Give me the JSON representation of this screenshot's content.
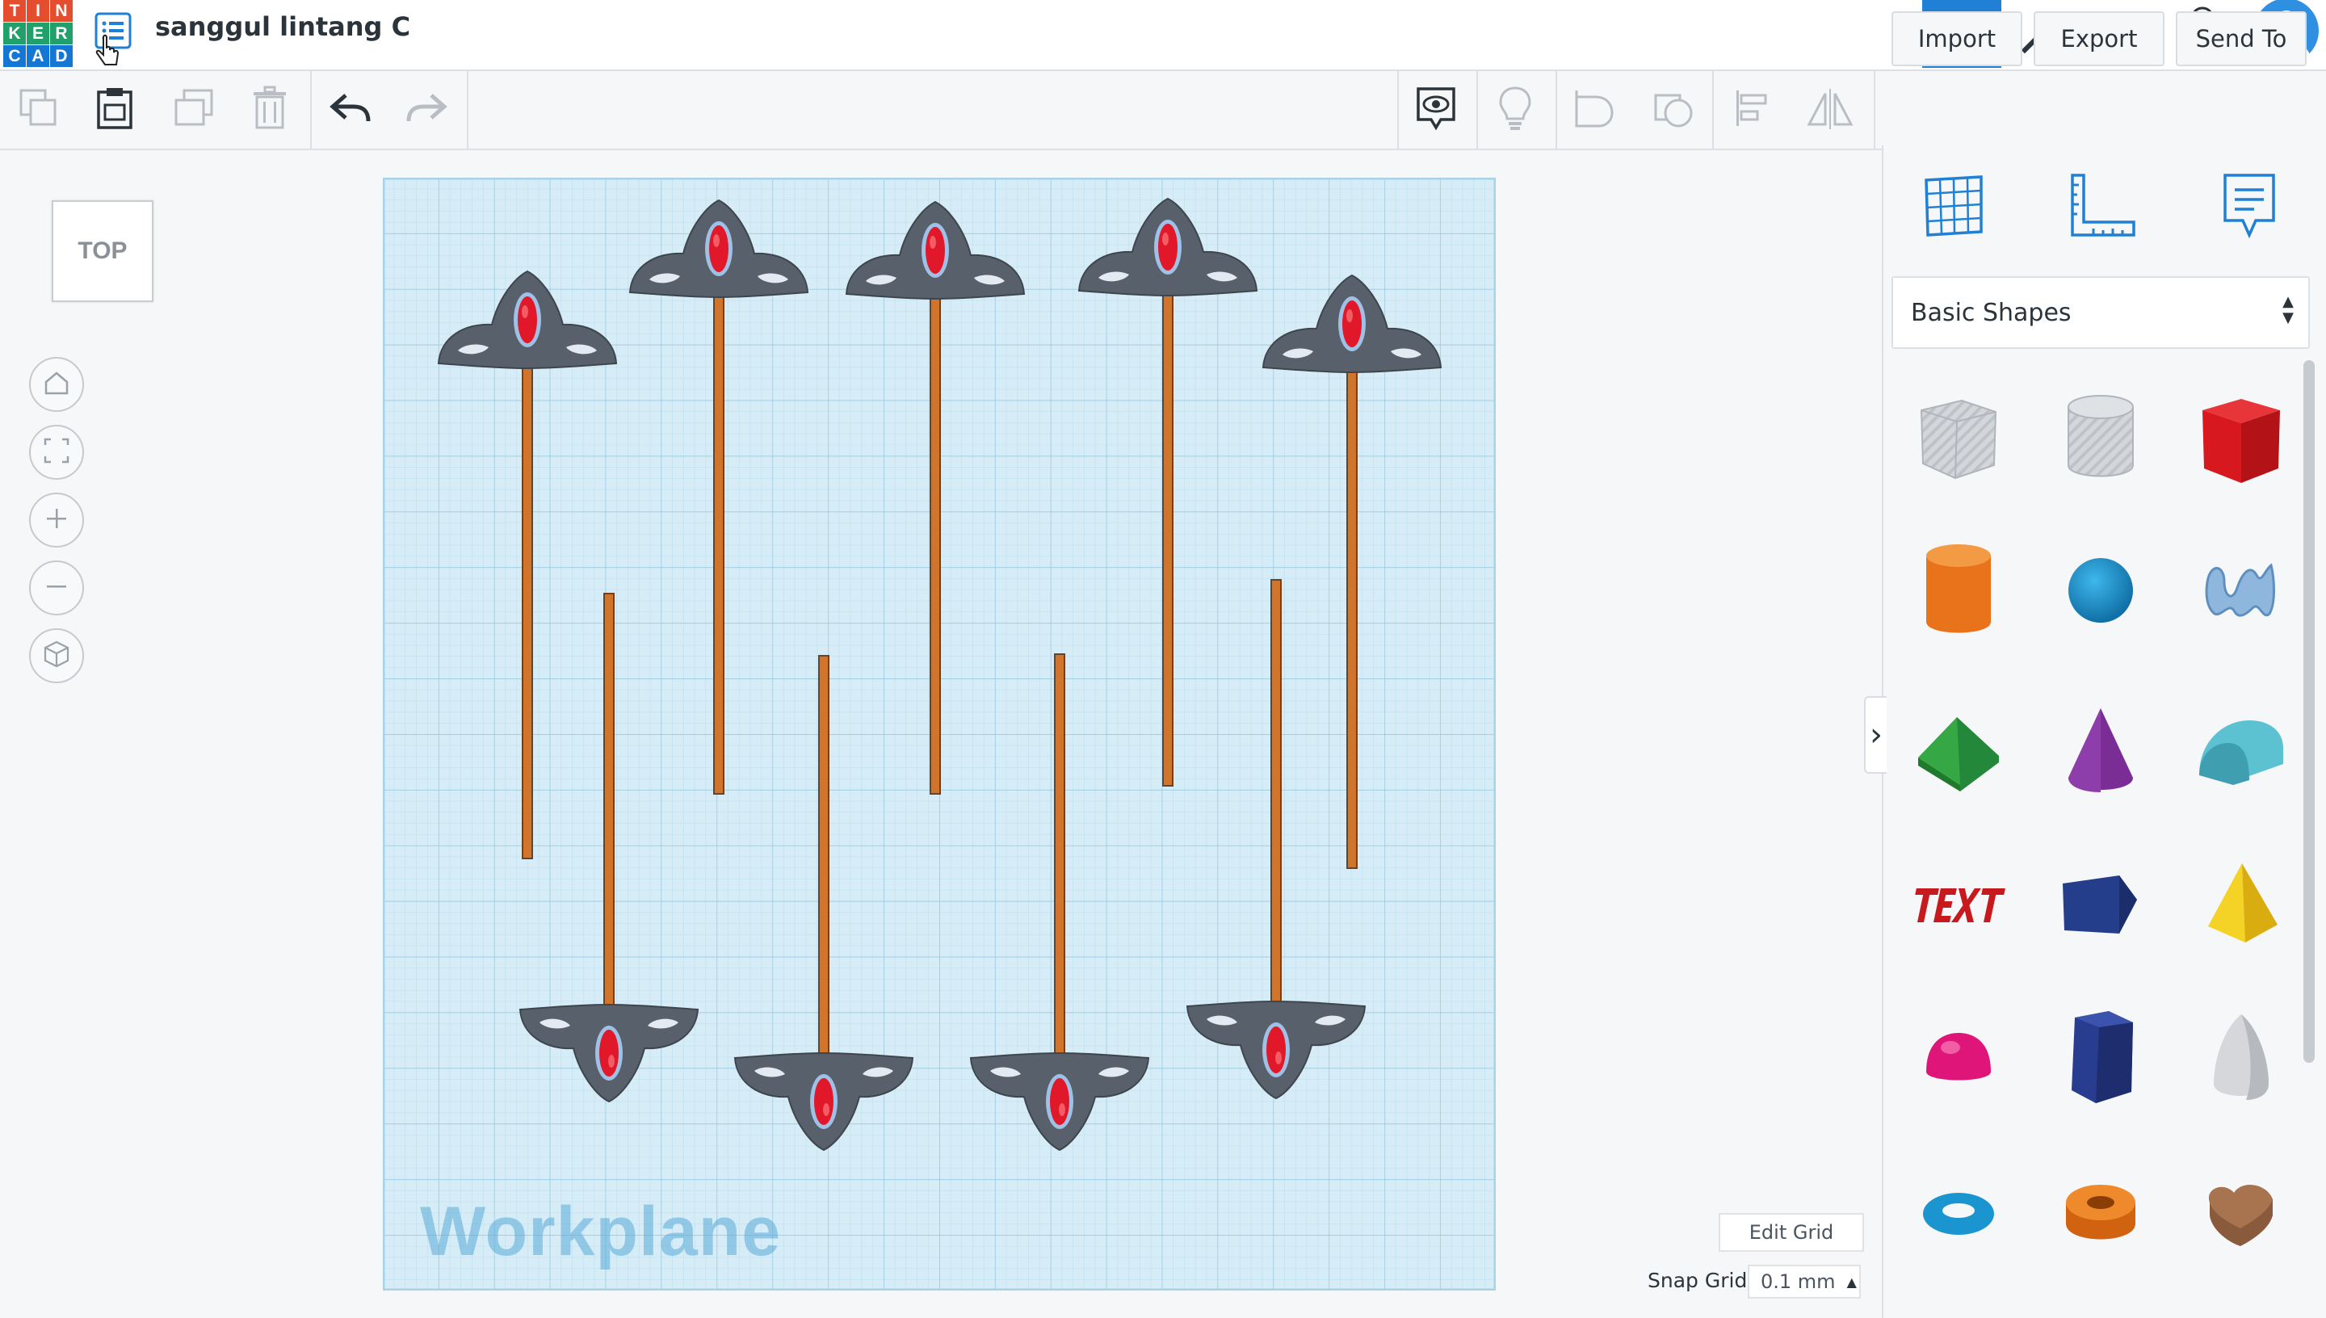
{
  "app": {
    "logo_letters": [
      "T",
      "I",
      "N",
      "K",
      "E",
      "R",
      "C",
      "A",
      "D"
    ],
    "logo_colors": [
      "#e44d2e",
      "#e44d2e",
      "#e44d2e",
      "#22a06b",
      "#22a06b",
      "#22a06b",
      "#1477d4",
      "#1477d4",
      "#1477d4"
    ],
    "design_title": "sanggul lintang C"
  },
  "toolbar": {
    "import_label": "Import",
    "export_label": "Export",
    "send_to_label": "Send To"
  },
  "viewport": {
    "view_cube_label": "TOP",
    "workplane_label": "Workplane",
    "edit_grid_label": "Edit Grid",
    "snap_grid_label": "Snap Grid",
    "snap_grid_value": "0.1 mm"
  },
  "shape_panel": {
    "library_selected": "Basic Shapes",
    "shapes": [
      {
        "name": "box-hole",
        "color": "#c9ccd1"
      },
      {
        "name": "cylinder-hole",
        "color": "#c9ccd1"
      },
      {
        "name": "box",
        "color": "#d7191f"
      },
      {
        "name": "cylinder",
        "color": "#ef7c1a"
      },
      {
        "name": "sphere",
        "color": "#1693cf"
      },
      {
        "name": "scribble",
        "color": "#8fb7dd"
      },
      {
        "name": "roof",
        "color": "#2f9e3c"
      },
      {
        "name": "cone",
        "color": "#7a2d95"
      },
      {
        "name": "round-roof",
        "color": "#56b8c8"
      },
      {
        "name": "text",
        "color": "#c8191e"
      },
      {
        "name": "polygon",
        "color": "#253e8c"
      },
      {
        "name": "pyramid",
        "color": "#f1c71c"
      },
      {
        "name": "half-sphere",
        "color": "#e0157a"
      },
      {
        "name": "hexagonal-prism",
        "color": "#283d8f"
      },
      {
        "name": "paraboloid",
        "color": "#d5d7da"
      },
      {
        "name": "torus",
        "color": "#1b95cf"
      },
      {
        "name": "tube",
        "color": "#e9731a"
      },
      {
        "name": "heart",
        "color": "#8a5a3c"
      }
    ]
  },
  "colors": {
    "accent_blue": "#1f80d6",
    "workplane_bg": "#d6edf7",
    "pin_body": "#58616b",
    "pin_stick": "#d2752c",
    "pin_gem": "#e0182a"
  }
}
